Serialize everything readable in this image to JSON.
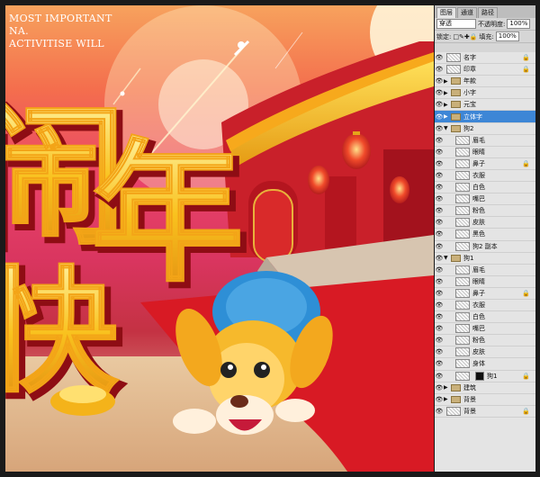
{
  "canvas": {
    "caption_lines": [
      "MOST IMPORTANT",
      "NA.",
      "ACTIVITISE WILL"
    ],
    "headline_chars": [
      "闹",
      "年",
      "快"
    ]
  },
  "panel": {
    "tabs": [
      "图层",
      "通道",
      "路径"
    ],
    "blend_mode": "穿透",
    "opacity_label": "不透明度:",
    "opacity_value": "100%",
    "lock_label": "锁定:",
    "fill_label": "填充:",
    "fill_value": "100%",
    "layers": [
      {
        "name": "名字",
        "type": "layer",
        "indent": 0,
        "lock": true
      },
      {
        "name": "印章",
        "type": "layer",
        "indent": 0,
        "lock": true
      },
      {
        "name": "年款",
        "type": "group",
        "indent": 0
      },
      {
        "name": "小字",
        "type": "group",
        "indent": 0
      },
      {
        "name": "元宝",
        "type": "group",
        "indent": 0
      },
      {
        "name": "立体字",
        "type": "group",
        "indent": 0,
        "selected": true
      },
      {
        "name": "狗2",
        "type": "group",
        "indent": 0,
        "open": true
      },
      {
        "name": "眉毛",
        "type": "layer",
        "indent": 1
      },
      {
        "name": "眼睛",
        "type": "layer",
        "indent": 1
      },
      {
        "name": "鼻子",
        "type": "layer",
        "indent": 1,
        "lock": true
      },
      {
        "name": "衣服",
        "type": "layer",
        "indent": 1
      },
      {
        "name": "白色",
        "type": "layer",
        "indent": 1
      },
      {
        "name": "嘴巴",
        "type": "layer",
        "indent": 1
      },
      {
        "name": "粉色",
        "type": "layer",
        "indent": 1
      },
      {
        "name": "皮肤",
        "type": "layer",
        "indent": 1
      },
      {
        "name": "黑色",
        "type": "layer",
        "indent": 1
      },
      {
        "name": "狗2 副本",
        "type": "layer",
        "indent": 1
      },
      {
        "name": "狗1",
        "type": "group",
        "indent": 0,
        "open": true
      },
      {
        "name": "眉毛",
        "type": "layer",
        "indent": 1
      },
      {
        "name": "眼睛",
        "type": "layer",
        "indent": 1
      },
      {
        "name": "鼻子",
        "type": "layer",
        "indent": 1,
        "lock": true
      },
      {
        "name": "衣服",
        "type": "layer",
        "indent": 1
      },
      {
        "name": "白色",
        "type": "layer",
        "indent": 1
      },
      {
        "name": "嘴巴",
        "type": "layer",
        "indent": 1
      },
      {
        "name": "粉色",
        "type": "layer",
        "indent": 1
      },
      {
        "name": "皮肤",
        "type": "layer",
        "indent": 1
      },
      {
        "name": "身体",
        "type": "layer",
        "indent": 1
      },
      {
        "name": "狗1",
        "type": "layer",
        "indent": 1,
        "mask": true,
        "lock": true
      },
      {
        "name": "建筑",
        "type": "group",
        "indent": 0
      },
      {
        "name": "背景",
        "type": "group",
        "indent": 0
      },
      {
        "name": "背景",
        "type": "layer",
        "indent": 0,
        "lock": true
      }
    ]
  }
}
